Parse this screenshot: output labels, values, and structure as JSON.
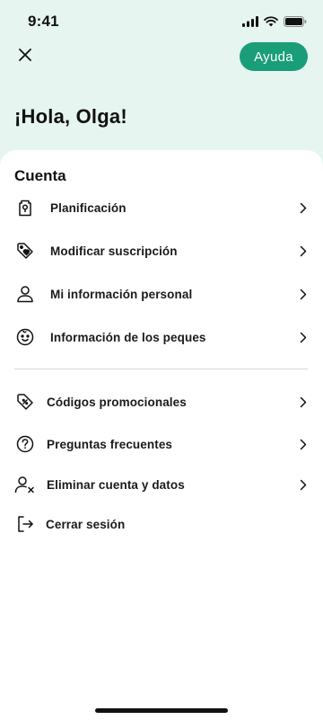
{
  "status_bar": {
    "time": "9:41",
    "icons": [
      "signal-icon",
      "wifi-icon",
      "battery-icon"
    ]
  },
  "header": {
    "close_icon": "close-icon",
    "help_label": "Ayuda",
    "greeting": "¡Hola, Olga!"
  },
  "colors": {
    "background_top": "#e6f5f0",
    "accent": "#1a9e7a",
    "sheet": "#ffffff",
    "text": "#1a1a1a",
    "divider": "#d6d6d6"
  },
  "account": {
    "title": "Cuenta",
    "items": [
      {
        "label": "Planificación",
        "icon": "planning-icon"
      },
      {
        "label": "Modificar suscripción",
        "icon": "price-tag-icon"
      },
      {
        "label": "Mi información personal",
        "icon": "person-icon"
      },
      {
        "label": "Información de los peques",
        "icon": "baby-face-icon"
      }
    ]
  },
  "more": {
    "items": [
      {
        "label": "Códigos promocionales",
        "icon": "discount-tag-icon"
      },
      {
        "label": "Preguntas frecuentes",
        "icon": "question-icon"
      },
      {
        "label": "Eliminar cuenta y datos",
        "icon": "remove-user-icon"
      },
      {
        "label": "Cerrar sesión",
        "icon": "logout-icon"
      }
    ]
  }
}
